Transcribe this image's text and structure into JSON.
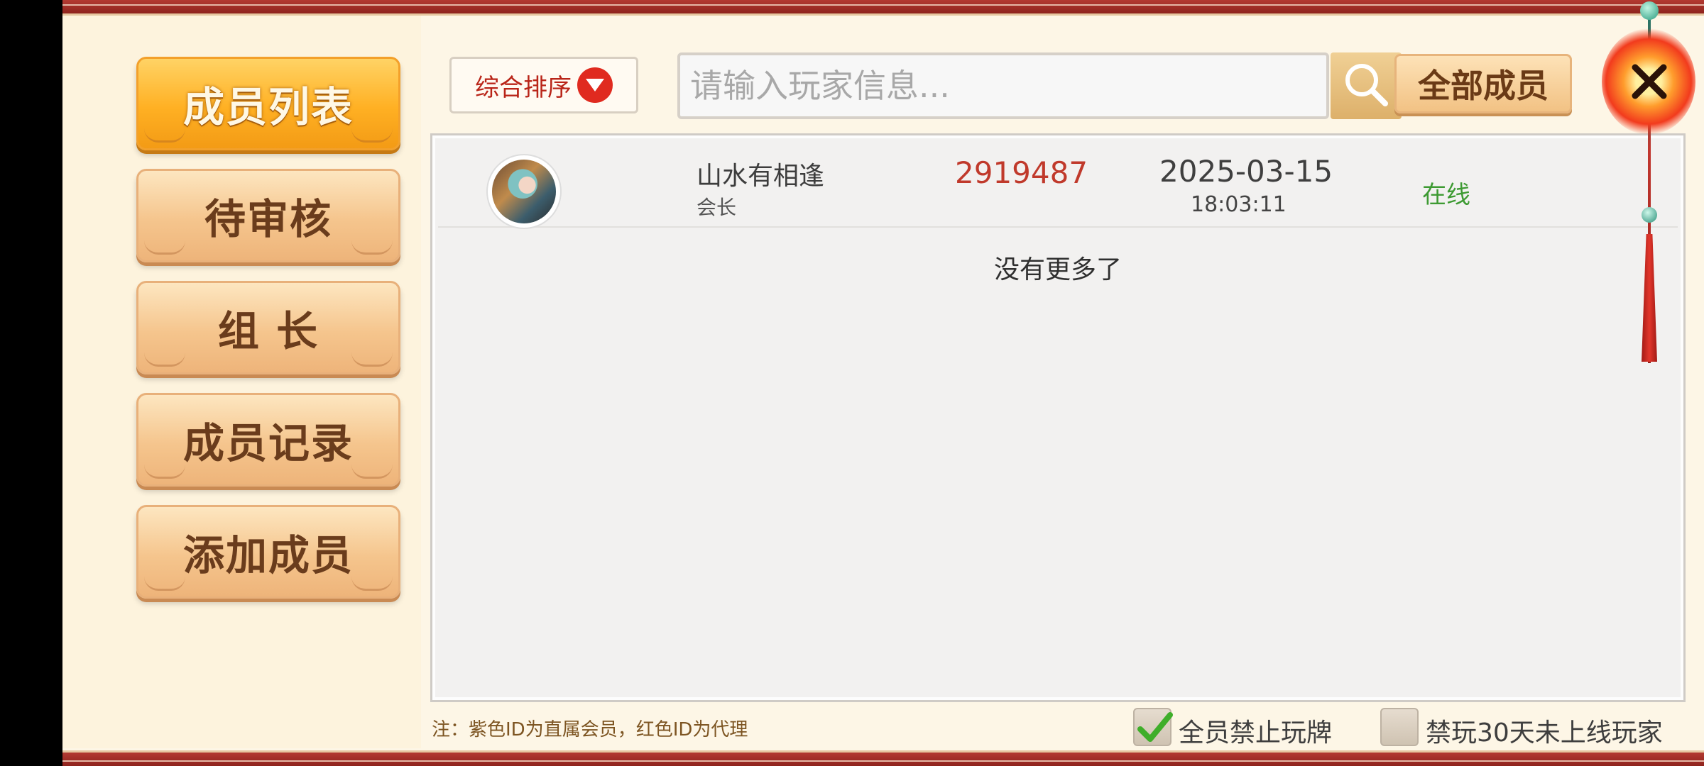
{
  "sidebar": {
    "items": [
      {
        "label": "成员列表",
        "active": true
      },
      {
        "label": "待审核",
        "active": false
      },
      {
        "label": "组 长",
        "active": false
      },
      {
        "label": "成员记录",
        "active": false
      },
      {
        "label": "添加成员",
        "active": false
      }
    ]
  },
  "toolbar": {
    "sort_label": "综合排序",
    "search_placeholder": "请输入玩家信息...",
    "search_icon": "search-icon",
    "filter_label": "全部成员",
    "close_icon": "close-icon"
  },
  "members": [
    {
      "name": "山水有相逢",
      "role": "会长",
      "id": "2919487",
      "date": "2025-03-15",
      "time": "18:03:11",
      "status": "在线"
    }
  ],
  "list_end_text": "没有更多了",
  "footer": {
    "note": "注：紫色ID为直属会员，红色ID为代理",
    "ban_all_label": "全员禁止玩牌",
    "ban_all_checked": true,
    "ban_inactive_label": "禁玩30天未上线玩家",
    "ban_inactive_checked": false
  },
  "colors": {
    "accent_red": "#c0392b",
    "online_green": "#3d9a32",
    "active_tab": "#ffb023"
  }
}
